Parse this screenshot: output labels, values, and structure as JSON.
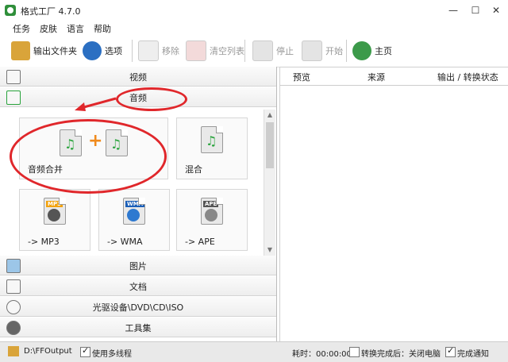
{
  "window": {
    "title": "格式工厂 4.7.0",
    "minimize": "—",
    "maximize": "☐",
    "close": "✕"
  },
  "menu": [
    "任务",
    "皮肤",
    "语言",
    "帮助"
  ],
  "toolbar": {
    "output_folder": "输出文件夹",
    "options": "选项",
    "remove": "移除",
    "clear_list": "清空列表",
    "stop": "停止",
    "start": "开始",
    "home": "主页"
  },
  "categories": {
    "video": "视频",
    "audio": "音频",
    "picture": "图片",
    "document": "文档",
    "optical": "光驱设备\\DVD\\CD\\ISO",
    "tools": "工具集"
  },
  "audio_tools": [
    {
      "label": "音频合并"
    },
    {
      "label": "混合"
    },
    {
      "label": "-> MP3",
      "badge": "MP3"
    },
    {
      "label": "-> WMA",
      "badge": "WMA"
    },
    {
      "label": "-> APE",
      "badge": "APE"
    }
  ],
  "task_table": {
    "columns": [
      "预览",
      "来源",
      "输出 / 转换状态"
    ]
  },
  "status": {
    "output_path": "D:\\FFOutput",
    "multithread": "使用多线程",
    "elapsed": "耗时：00:00:00",
    "after_convert": "转换完成后：关闭电脑",
    "notify": "完成通知"
  },
  "colors": {
    "accent_red": "#e0272b",
    "note_green": "#29a33c"
  }
}
